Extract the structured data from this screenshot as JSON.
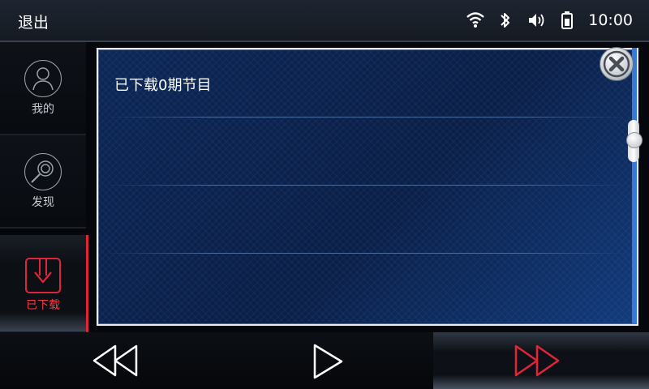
{
  "header": {
    "exit_label": "退出",
    "time": "10:00",
    "icons": [
      "wifi-icon",
      "bluetooth-icon",
      "volume-icon",
      "battery-icon"
    ]
  },
  "sidebar": {
    "items": [
      {
        "label": "我的",
        "icon": "person-icon",
        "active": false
      },
      {
        "label": "发现",
        "icon": "discover-icon",
        "active": false
      },
      {
        "label": "已下载",
        "icon": "download-icon",
        "active": true
      }
    ]
  },
  "main": {
    "title": "已下载0期节目"
  },
  "controls": {
    "buttons": [
      "rewind-icon",
      "play-icon",
      "fast-forward-icon"
    ]
  },
  "colors": {
    "accent": "#e0253a",
    "panel_bg": "#0b1e45",
    "panel_border": "#3a78d8"
  }
}
